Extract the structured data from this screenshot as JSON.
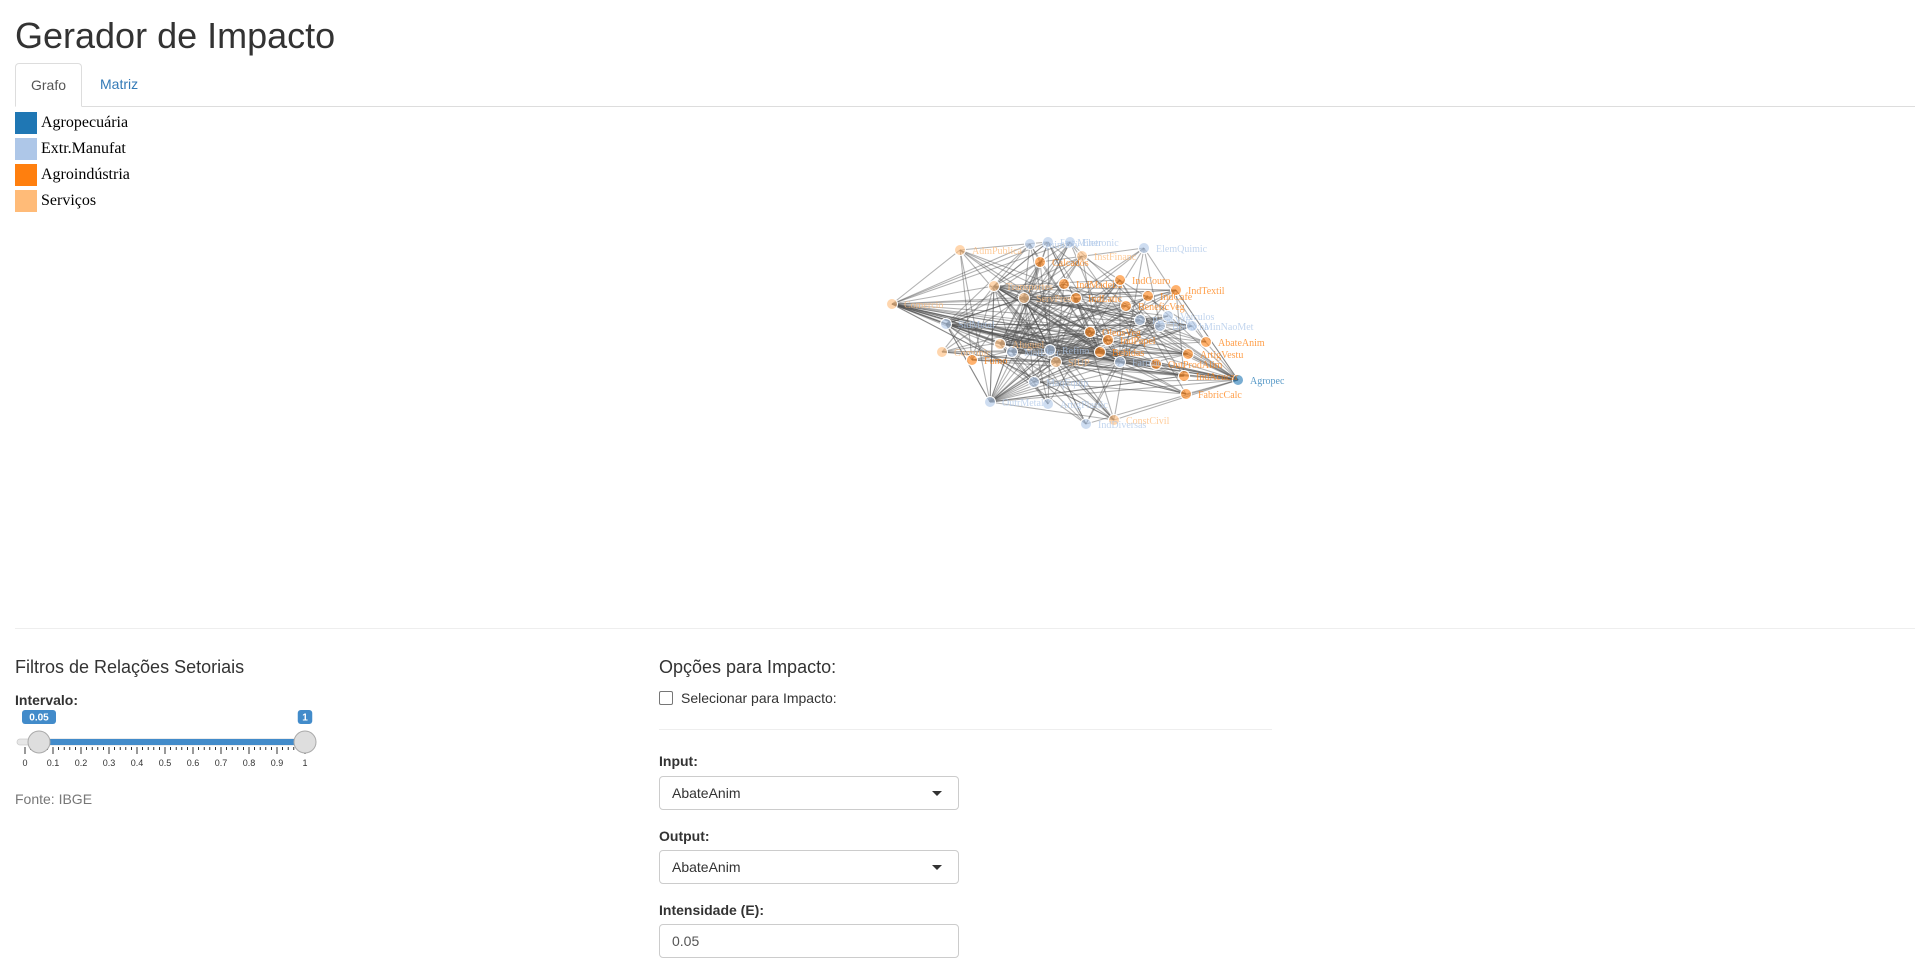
{
  "page": {
    "title": "Gerador de Impacto"
  },
  "tabs": [
    {
      "label": "Grafo",
      "active": true
    },
    {
      "label": "Matriz",
      "active": false
    }
  ],
  "legend": [
    {
      "label": "Agropecuária",
      "color": "#1f77b4"
    },
    {
      "label": "Extr.Manufat",
      "color": "#aec7e8"
    },
    {
      "label": "Agroindústria",
      "color": "#ff7f0e"
    },
    {
      "label": "Serviços",
      "color": "#ffbb78"
    }
  ],
  "graph": {
    "nodes": [
      {
        "label": "Agropec",
        "group": "Agropecuária"
      },
      {
        "label": "ExtrMiner",
        "group": "Extr.Manufat"
      },
      {
        "label": "ElemQuimic",
        "group": "Extr.Manufat"
      },
      {
        "label": "Comercio",
        "group": "Serviços"
      },
      {
        "label": "IndTextil",
        "group": "Agroindústria"
      },
      {
        "label": "AbateAnim",
        "group": "Agroindústria"
      },
      {
        "label": "ArtigVestu",
        "group": "Agroindústria"
      },
      {
        "label": "OutProdAlim",
        "group": "Agroindústria"
      },
      {
        "label": "IndAcucar",
        "group": "Agroindústria"
      },
      {
        "label": "FabricCalc",
        "group": "Agroindústria"
      },
      {
        "label": "ConstCivil",
        "group": "Serviços"
      },
      {
        "label": "IndDiversas",
        "group": "Extr.Manufat"
      },
      {
        "label": "ArtigPlastic",
        "group": "Extr.Manufat"
      },
      {
        "label": "OutrMetal",
        "group": "Extr.Manufat"
      },
      {
        "label": "MaqEquip",
        "group": "Extr.Manufat"
      },
      {
        "label": "MatEletr",
        "group": "Extr.Manufat"
      },
      {
        "label": "SidMetal",
        "group": "Extr.Manufat"
      },
      {
        "label": "IndMadeira",
        "group": "Agroindústria"
      },
      {
        "label": "IndCouro",
        "group": "Agroindústria"
      },
      {
        "label": "IndCafe",
        "group": "Agroindústria"
      },
      {
        "label": "BeneficVeg",
        "group": "Agroindústria"
      },
      {
        "label": "IndLatic",
        "group": "Agroindústria"
      },
      {
        "label": "OleosVeg",
        "group": "Agroindústria"
      },
      {
        "label": "IndPapel",
        "group": "Agroindústria"
      },
      {
        "label": "Transportes",
        "group": "Serviços"
      },
      {
        "label": "ServPrest",
        "group": "Serviços"
      },
      {
        "label": "AdmPublica",
        "group": "Serviços"
      },
      {
        "label": "InstFinanc",
        "group": "Serviços"
      },
      {
        "label": "Comunic",
        "group": "Serviços"
      },
      {
        "label": "Aluguel",
        "group": "Serviços"
      },
      {
        "label": "SIUP",
        "group": "Serviços"
      },
      {
        "label": "Refino",
        "group": "Extr.Manufat"
      },
      {
        "label": "Farmac",
        "group": "Extr.Manufat"
      },
      {
        "label": "Borracha",
        "group": "Extr.Manufat"
      },
      {
        "label": "MinNaoMet",
        "group": "Extr.Manufat"
      },
      {
        "label": "Veiculos",
        "group": "Extr.Manufat"
      },
      {
        "label": "PecasVeic",
        "group": "Extr.Manufat"
      },
      {
        "label": "Eletronic",
        "group": "Extr.Manufat"
      },
      {
        "label": "QuimDiv",
        "group": "Extr.Manufat"
      },
      {
        "label": "Calcados",
        "group": "Agroindústria"
      },
      {
        "label": "Fumo",
        "group": "Agroindústria"
      },
      {
        "label": "Bebidas",
        "group": "Agroindústria"
      }
    ]
  },
  "filters": {
    "title": "Filtros de Relações Setoriais",
    "range_label": "Intervalo:",
    "range_min": 0,
    "range_max": 1,
    "range_low": 0.05,
    "range_high": 1,
    "low_badge": "0.05",
    "high_badge": "1",
    "tick_labels": [
      "0",
      "0.1",
      "0.2",
      "0.3",
      "0.4",
      "0.5",
      "0.6",
      "0.7",
      "0.8",
      "0.9",
      "1"
    ],
    "source": "Fonte: IBGE",
    "accent": "#428bca"
  },
  "impact": {
    "title": "Opções para Impacto:",
    "checkbox_label": "Selecionar para Impacto:",
    "checked": false,
    "input_label": "Input:",
    "input_value": "AbateAnim",
    "output_label": "Output:",
    "output_value": "AbateAnim",
    "intensity_label": "Intensidade (E):",
    "intensity_value": "0.05"
  }
}
